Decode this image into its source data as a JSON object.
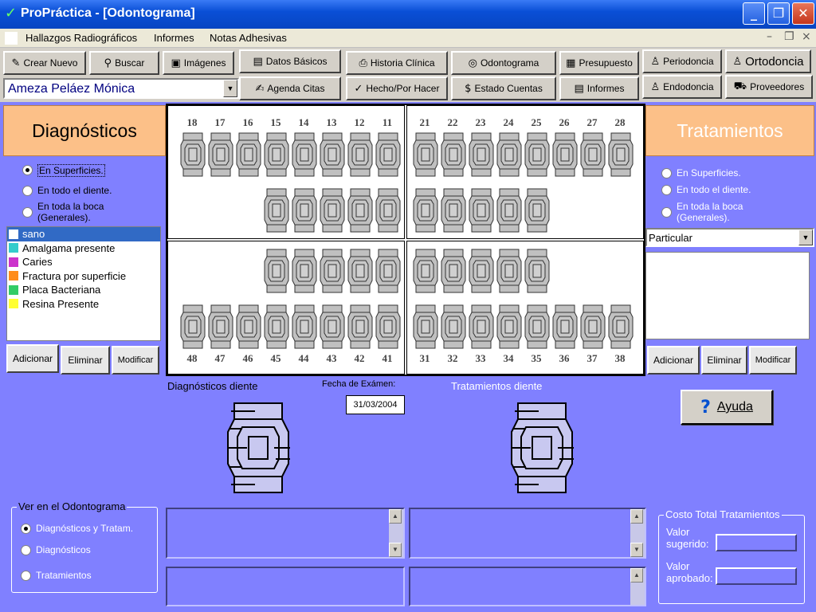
{
  "window": {
    "title": "ProPráctica - [Odontograma]",
    "min": "_",
    "restore": "❐",
    "close": "✕"
  },
  "menu": {
    "items": [
      "Hallazgos Radiográficos",
      "Informes",
      "Notas Adhesivas"
    ],
    "mdi_min": "–",
    "mdi_restore": "❐",
    "mdi_close": "×"
  },
  "toolbar": {
    "crear_nuevo": "Crear Nuevo",
    "buscar": "Buscar",
    "imagenes": "Imágenes",
    "datos_basicos": "Datos Básicos",
    "historia_clinica": "Historia Clínica",
    "odontograma": "Odontograma",
    "presupuesto": "Presupuesto",
    "periodoncia": "Periodoncia",
    "ortodoncia": "Ortodoncia",
    "agenda_citas": "Agenda Citas",
    "hecho_por_hacer": "Hecho/Por Hacer",
    "estado_cuentas": "Estado Cuentas",
    "informes": "Informes",
    "endodoncia": "Endodoncia",
    "proveedores": "Proveedores"
  },
  "patient": {
    "name": "Ameza Peláez Mónica"
  },
  "diagnosticos": {
    "title": "Diagnósticos",
    "options": [
      "En Superficies.",
      "En todo el diente.",
      "En toda la boca (Generales)."
    ],
    "selected_option": 0,
    "list": [
      {
        "label": "sano",
        "color": "#ffffff",
        "selected": true
      },
      {
        "label": "Amalgama presente",
        "color": "#33cccc"
      },
      {
        "label": "Caries",
        "color": "#cc33cc"
      },
      {
        "label": "Fractura por superficie",
        "color": "#ff8c1a"
      },
      {
        "label": "Placa Bacteriana",
        "color": "#33cc66"
      },
      {
        "label": "Resina Presente",
        "color": "#ffff33"
      }
    ],
    "btn_add": "Adicionar",
    "btn_del": "Eliminar",
    "btn_mod": "Modificar"
  },
  "tratamientos": {
    "title": "Tratamientos",
    "options": [
      "En Superficies.",
      "En todo el diente.",
      "En toda la boca (Generales)."
    ],
    "category": "Particular",
    "btn_add": "Adicionar",
    "btn_del": "Eliminar",
    "btn_mod": "Modificar"
  },
  "odontogram": {
    "upper_right": [
      "18",
      "17",
      "16",
      "15",
      "14",
      "13",
      "12",
      "11"
    ],
    "upper_left": [
      "21",
      "22",
      "23",
      "24",
      "25",
      "26",
      "27",
      "28"
    ],
    "lower_right": [
      "48",
      "47",
      "46",
      "45",
      "44",
      "43",
      "42",
      "41"
    ],
    "lower_left": [
      "31",
      "32",
      "33",
      "34",
      "35",
      "36",
      "37",
      "38"
    ]
  },
  "detail": {
    "diag_tooth_label": "Diagnósticos diente",
    "exam_date_label": "Fecha de Exámen:",
    "exam_date": "31/03/2004",
    "trat_tooth_label": "Tratamientos diente",
    "help": "Ayuda",
    "help_icon": "?"
  },
  "view": {
    "title": "Ver en el Odontograma",
    "options": [
      "Diagnósticos y Tratam.",
      "Diagnósticos",
      "Tratamientos"
    ],
    "selected_option": 0
  },
  "cost": {
    "title": "Costo Total Tratamientos",
    "sugerido_label": "Valor sugerido:",
    "aprobado_label": "Valor aprobado:"
  },
  "colors": {
    "panel_bg": "#8080ff",
    "header_bg": "#fcc088",
    "title_bar": "#0a4fd6"
  }
}
